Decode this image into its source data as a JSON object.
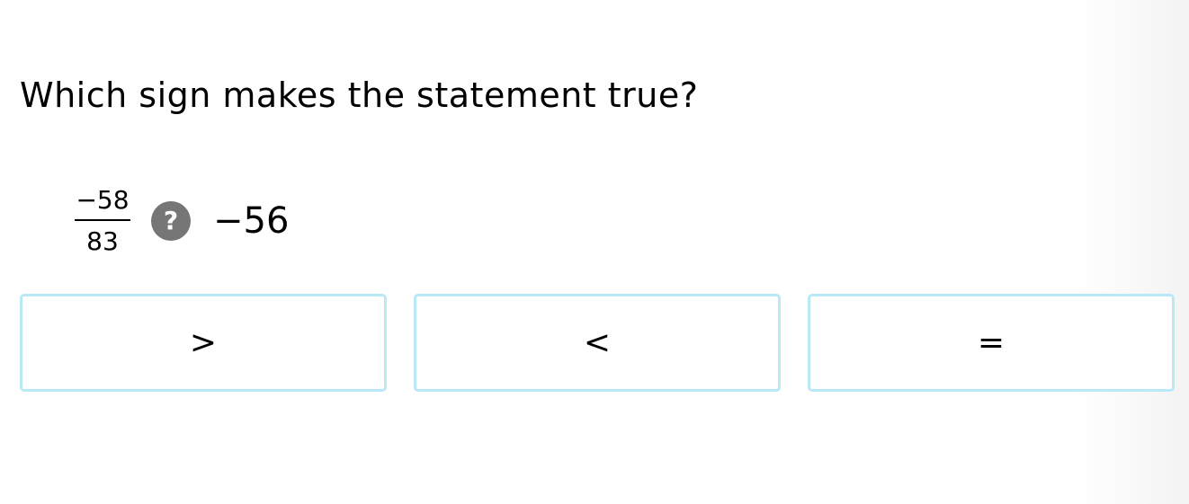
{
  "question": {
    "prompt": "Which sign makes the statement true?"
  },
  "expression": {
    "numerator": "−58",
    "denominator": "83",
    "unknown_symbol": "?",
    "rhs": "−56",
    "unknown_icon": "question-circle-icon"
  },
  "choices": [
    {
      "label": ">"
    },
    {
      "label": "<"
    },
    {
      "label": "="
    }
  ],
  "colors": {
    "choice_border": "#b9e8f6",
    "unknown_badge": "#767676"
  }
}
